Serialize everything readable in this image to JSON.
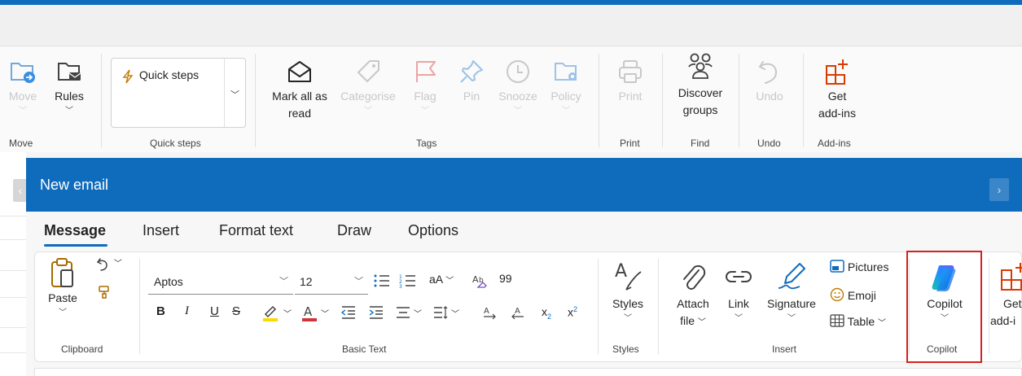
{
  "main_ribbon": {
    "move_group": {
      "label": "Move",
      "move": "Move",
      "rules": "Rules"
    },
    "quick_steps_group": {
      "label": "Quick steps",
      "quick_steps": "Quick steps"
    },
    "tags_group": {
      "label": "Tags",
      "mark_all_read_line1": "Mark all as",
      "mark_all_read_line2": "read",
      "categorise": "Categorise",
      "flag": "Flag",
      "pin": "Pin",
      "snooze": "Snooze",
      "policy": "Policy"
    },
    "print_group": {
      "label": "Print",
      "print": "Print"
    },
    "find_group": {
      "label": "Find",
      "discover_line1": "Discover",
      "discover_line2": "groups"
    },
    "undo_group": {
      "label": "Undo",
      "undo": "Undo"
    },
    "addins_group": {
      "label": "Add-ins",
      "get_line1": "Get",
      "get_line2": "add-ins"
    }
  },
  "compose": {
    "title": "New email",
    "tabs": [
      "Message",
      "Insert",
      "Format text",
      "Draw",
      "Options"
    ],
    "active_tab": "Message",
    "clipboard": {
      "label": "Clipboard",
      "paste": "Paste"
    },
    "basic_text": {
      "label": "Basic Text",
      "font": "Aptos",
      "size": "12",
      "change_case": "aA",
      "bold": "B",
      "italic": "I",
      "underline": "U",
      "strikethrough": "S",
      "subscript": "x",
      "subscript_mark": "2",
      "superscript": "x",
      "superscript_mark": "2"
    },
    "styles": {
      "label": "Styles",
      "styles": "Styles"
    },
    "insert": {
      "label": "Insert",
      "attach_line1": "Attach",
      "attach_line2": "file",
      "link": "Link",
      "signature": "Signature",
      "pictures": "Pictures",
      "emoji": "Emoji",
      "table": "Table"
    },
    "copilot": {
      "label": "Copilot",
      "copilot": "Copilot"
    },
    "get_addins_partial_line1": "Get",
    "get_addins_partial_line2": "add-i"
  },
  "colors": {
    "accent": "#0f6cbd",
    "highlight_outline": "#d42121",
    "highlight_yellow": "#ffd800",
    "font_red": "#d13438",
    "addin_orange": "#d83b01"
  }
}
